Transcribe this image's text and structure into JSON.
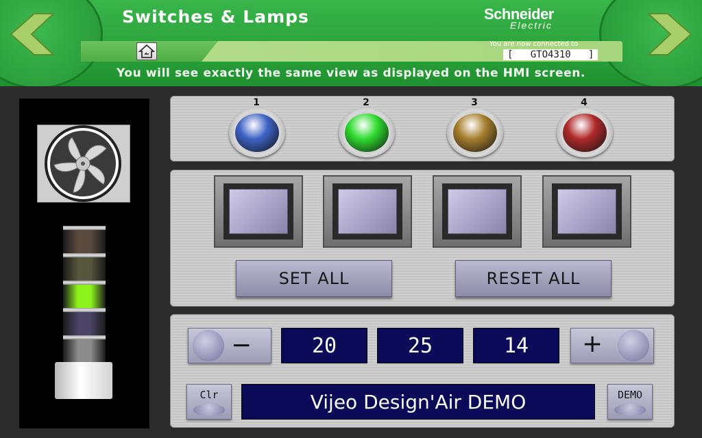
{
  "header": {
    "title": "Switches & Lamps",
    "logo_line1": "Schneider",
    "logo_line2": "Electric",
    "connected_label": "You are now connected to",
    "connected_value": "[   GTO4310   ]",
    "subtitle": "You will see exactly the same view as displayed on the HMI screen.",
    "brand_green": "#2aa23a"
  },
  "lamps": [
    {
      "label": "1",
      "color": "#3f63c6"
    },
    {
      "label": "2",
      "color": "#2fdc2f"
    },
    {
      "label": "3",
      "color": "#a8802f"
    },
    {
      "label": "4",
      "color": "#b02a2a"
    }
  ],
  "switches": {
    "set_all_label": "SET ALL",
    "reset_all_label": "RESET ALL"
  },
  "stack_light": {
    "segments": [
      "#5b4a3e",
      "#56563c",
      "#8ef31d",
      "#4a4366",
      "#8c8c8c"
    ]
  },
  "controls": {
    "value_1": "20",
    "value_2": "25",
    "value_3": "14",
    "minus_label": "−",
    "plus_label": "+",
    "clear_label": "Clr",
    "demo_label": "DEMO",
    "message": "Vijeo Design'Air DEMO"
  }
}
